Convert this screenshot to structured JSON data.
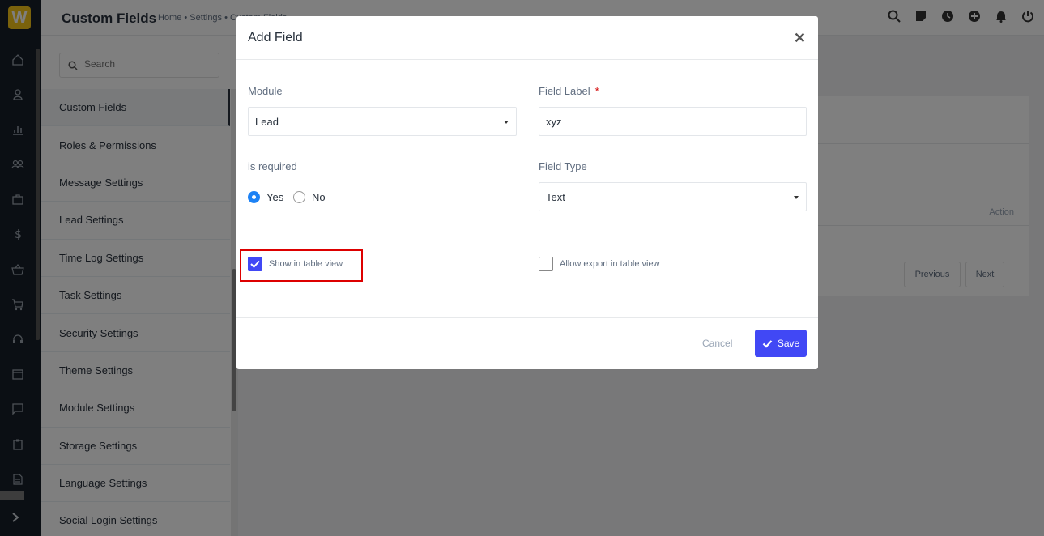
{
  "app": {
    "logo_letter": "W"
  },
  "header": {
    "title": "Custom Fields",
    "breadcrumb": "Home • Settings • Custom Fields"
  },
  "settings": {
    "search_placeholder": "Search",
    "items": [
      "Custom Fields",
      "Roles & Permissions",
      "Message Settings",
      "Lead Settings",
      "Time Log Settings",
      "Task Settings",
      "Security Settings",
      "Theme Settings",
      "Module Settings",
      "Storage Settings",
      "Language Settings",
      "Social Login Settings"
    ]
  },
  "background": {
    "action_header": "Action",
    "previous": "Previous",
    "next": "Next"
  },
  "modal": {
    "title": "Add Field",
    "module_label": "Module",
    "module_value": "Lead",
    "field_label_label": "Field Label",
    "required_mark": "*",
    "field_label_value": "xyz",
    "is_required_label": "is required",
    "yes_label": "Yes",
    "no_label": "No",
    "field_type_label": "Field Type",
    "field_type_value": "Text",
    "show_in_table_label": "Show in table view",
    "allow_export_label": "Allow export in table view",
    "cancel_label": "Cancel",
    "save_label": "Save"
  },
  "colors": {
    "accent": "#4148f5",
    "highlight": "#dd0000",
    "rail": "#171f29"
  }
}
